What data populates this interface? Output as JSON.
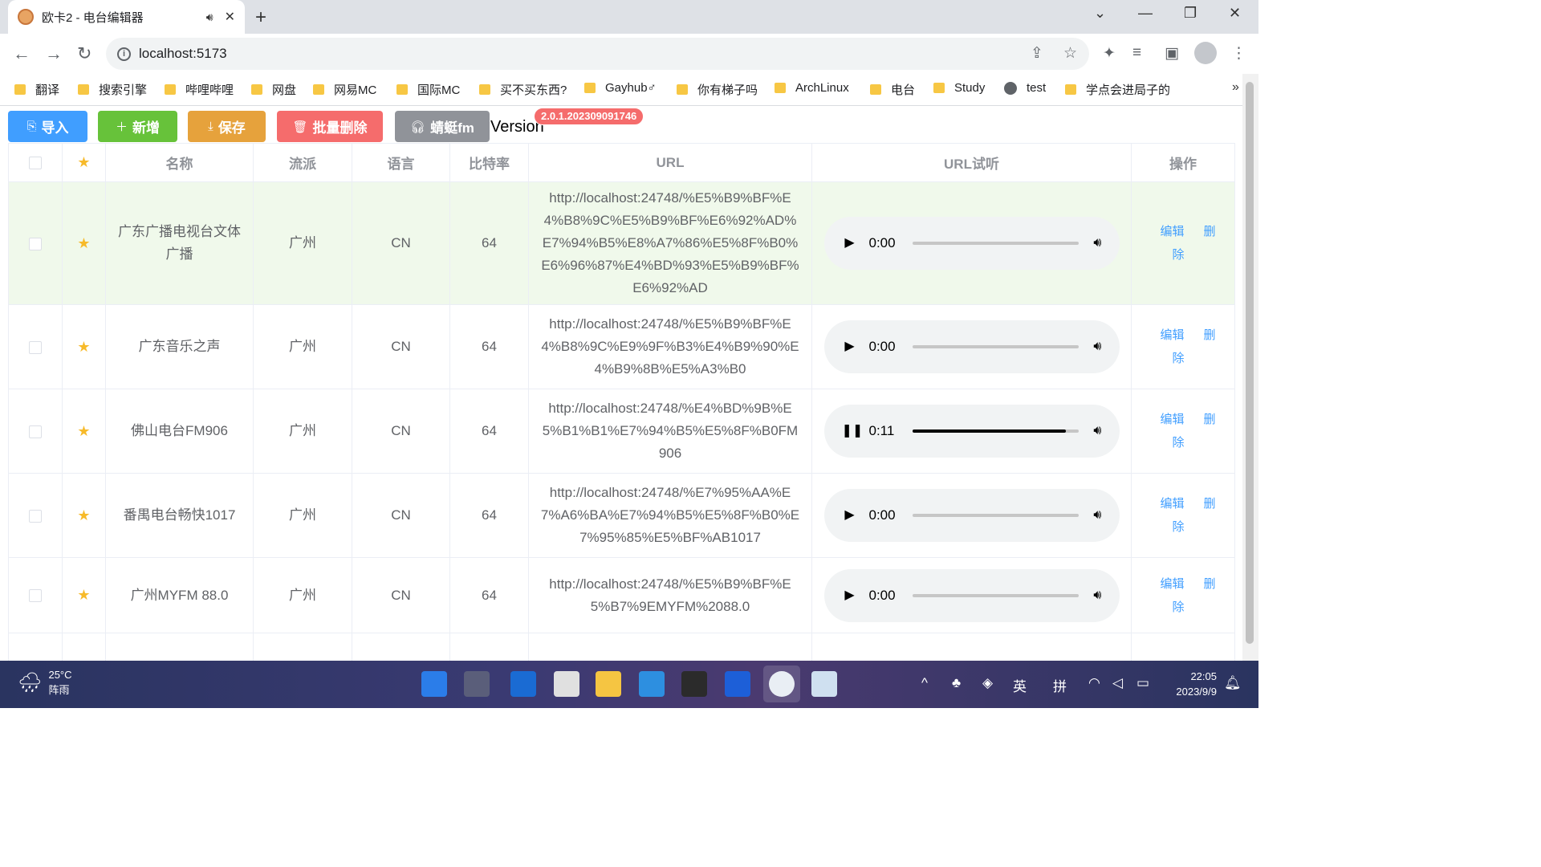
{
  "browser": {
    "tab_title": "欧卡2 - 电台编辑器",
    "audio_icon": "speaker-icon",
    "close_glyph": "✕",
    "newtab_glyph": "+",
    "url": "localhost:5173",
    "win_min": "—",
    "win_max": "❐",
    "win_close": "✕",
    "chevron": "⌄"
  },
  "bookmarks": [
    {
      "label": "翻译",
      "icon": "folder"
    },
    {
      "label": "搜索引擎",
      "icon": "folder"
    },
    {
      "label": "哔哩哔哩",
      "icon": "folder"
    },
    {
      "label": "网盘",
      "icon": "folder"
    },
    {
      "label": "网易MC",
      "icon": "folder"
    },
    {
      "label": "国际MC",
      "icon": "folder"
    },
    {
      "label": "买不买东西?",
      "icon": "folder"
    },
    {
      "label": "Gayhub♂",
      "icon": "folder"
    },
    {
      "label": "你有梯子吗",
      "icon": "folder"
    },
    {
      "label": "ArchLinux",
      "icon": "folder"
    },
    {
      "label": "电台",
      "icon": "folder"
    },
    {
      "label": "Study",
      "icon": "folder"
    },
    {
      "label": "test",
      "icon": "globe"
    },
    {
      "label": "学点会进局子的",
      "icon": "folder"
    }
  ],
  "bookmarks_more": "»",
  "toolbar": {
    "import_label": "导入",
    "add_label": "新增",
    "save_label": "保存",
    "batch_delete_label": "批量删除",
    "fm_label": "蜻蜓fm",
    "version_label": "Version",
    "version_value": "2.0.1.202309091746"
  },
  "table": {
    "headers": [
      "",
      "★",
      "名称",
      "流派",
      "语言",
      "比特率",
      "URL",
      "URL试听",
      "操作"
    ],
    "edit_label": "编辑",
    "delete_label": "删除",
    "rows": [
      {
        "name": "广东广播电视台文体广播",
        "genre": "广州",
        "lang": "CN",
        "bitrate": "64",
        "url": "http://localhost:24748/%E5%B9%BF%E4%B8%9C%E5%B9%BF%E6%92%AD%E7%94%B5%E8%A7%86%E5%8F%B0%E6%96%87%E4%BD%93%E5%B9%BF%E6%92%AD",
        "time": "0:00",
        "playing": false,
        "progress": 0,
        "highlight": true
      },
      {
        "name": "广东音乐之声",
        "genre": "广州",
        "lang": "CN",
        "bitrate": "64",
        "url": "http://localhost:24748/%E5%B9%BF%E4%B8%9C%E9%9F%B3%E4%B9%90%E4%B9%8B%E5%A3%B0",
        "time": "0:00",
        "playing": false,
        "progress": 0,
        "highlight": false
      },
      {
        "name": "佛山电台FM906",
        "genre": "广州",
        "lang": "CN",
        "bitrate": "64",
        "url": "http://localhost:24748/%E4%BD%9B%E5%B1%B1%E7%94%B5%E5%8F%B0FM906",
        "time": "0:11",
        "playing": true,
        "progress": 0.92,
        "highlight": false
      },
      {
        "name": "番禺电台畅快1017",
        "genre": "广州",
        "lang": "CN",
        "bitrate": "64",
        "url": "http://localhost:24748/%E7%95%AA%E7%A6%BA%E7%94%B5%E5%8F%B0%E7%95%85%E5%BF%AB1017",
        "time": "0:00",
        "playing": false,
        "progress": 0,
        "highlight": false
      },
      {
        "name": "广州MYFM 88.0",
        "genre": "广州",
        "lang": "CN",
        "bitrate": "64",
        "url": "http://localhost:24748/%E5%B9%BF%E5%B7%9EMYFM%2088.0",
        "time": "0:00",
        "playing": false,
        "progress": 0,
        "highlight": false
      }
    ]
  },
  "taskbar": {
    "temperature": "25°C",
    "weather": "阵雨",
    "ime_lang": "英",
    "ime_mode": "拼",
    "time": "22:05",
    "date": "2023/9/9"
  },
  "colors": {
    "primary": "#409eff",
    "success": "#67c23a",
    "warning": "#e6a23c",
    "danger": "#f56c6c",
    "info": "#909399",
    "row_highlight": "#f0f9eb"
  }
}
